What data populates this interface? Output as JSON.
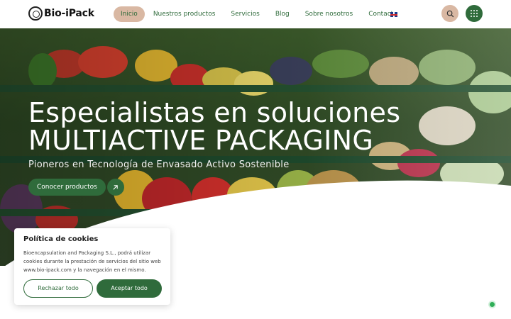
{
  "header": {
    "logo_text": "Bio-iPack",
    "nav": [
      {
        "label": "Inicio",
        "active": true
      },
      {
        "label": "Nuestros productos",
        "active": false
      },
      {
        "label": "Servicios",
        "active": false
      },
      {
        "label": "Blog",
        "active": false
      },
      {
        "label": "Sobre nosotros",
        "active": false
      },
      {
        "label": "Contacto",
        "active": false
      }
    ],
    "language_icon": "uk-flag-icon",
    "search_icon": "search-icon",
    "menu_icon": "grid-menu-icon"
  },
  "hero": {
    "title_line1": "Especialistas en soluciones",
    "title_line2": "MULTIACTIVE PACKAGING",
    "subtitle": "Pioneros en Tecnología de Envasado Activo Sostenible",
    "cta_label": "Conocer productos",
    "cta_icon": "arrow-up-right-icon"
  },
  "cookie": {
    "title": "Política de cookies",
    "text": "Bioencapsulation and Packaging S.L., podrá utilizar cookies durante la prestación de servicios del sitio web www.bio-ipack.com y la navegación en el mismo.",
    "reject_label": "Rechazar todo",
    "accept_label": "Aceptar todo"
  },
  "colors": {
    "brand_green": "#2f6b3b",
    "accent_tan": "#d9b8a3"
  }
}
